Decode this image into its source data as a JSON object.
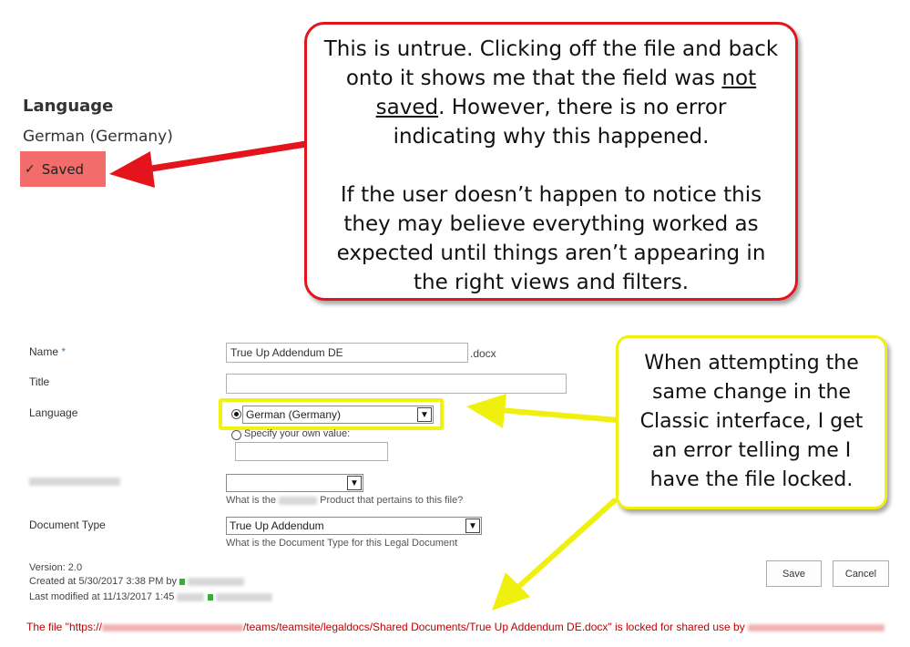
{
  "modern_panel": {
    "heading": "Language",
    "value": "German (Germany)",
    "saved_badge": "Saved",
    "saved_icon": "checkmark-icon"
  },
  "red_callout": {
    "para1_a": "This is untrue.  Clicking off the file and back onto it shows me that the field was ",
    "para1_underline": "not saved",
    "para1_b": ".  However, there is no error indicating why this happened.",
    "para2": "If the user doesn’t happen to notice this they may believe everything worked as expected until things aren’t appearing in the right views and filters.",
    "border_color": "#e3141b"
  },
  "classic_form": {
    "name_label": "Name",
    "required_mark": " *",
    "name_value": "True Up Addendum DE",
    "name_ext": ".docx",
    "title_label": "Title",
    "title_value": "",
    "language_label": "Language",
    "language_selected": "German (Germany)",
    "specify_own_label": "Specify your own value:",
    "specify_own_value": "",
    "product_hint_a": "What is the",
    "product_hint_b": "Product that pertains to this file?",
    "product_value": "",
    "doctype_label": "Document Type",
    "doctype_value": "True Up Addendum",
    "doctype_hint": "What is the Document Type for this Legal Document",
    "version": "Version: 2.0",
    "created": "Created at 5/30/2017 3:38 PM  by",
    "modified": "Last modified at 11/13/2017 1:45",
    "save_button": "Save",
    "cancel_button": "Cancel",
    "error_a": "The file \"https://",
    "error_b": "/teams/teamsite/legaldocs/Shared Documents/True Up Addendum DE.docx\" is locked for shared use by",
    "error_color": "#c00000"
  },
  "yellow_callout": {
    "text": "When attempting the same change in the Classic interface, I get an error telling me I have the file locked.",
    "border_color": "#f0f00f"
  }
}
